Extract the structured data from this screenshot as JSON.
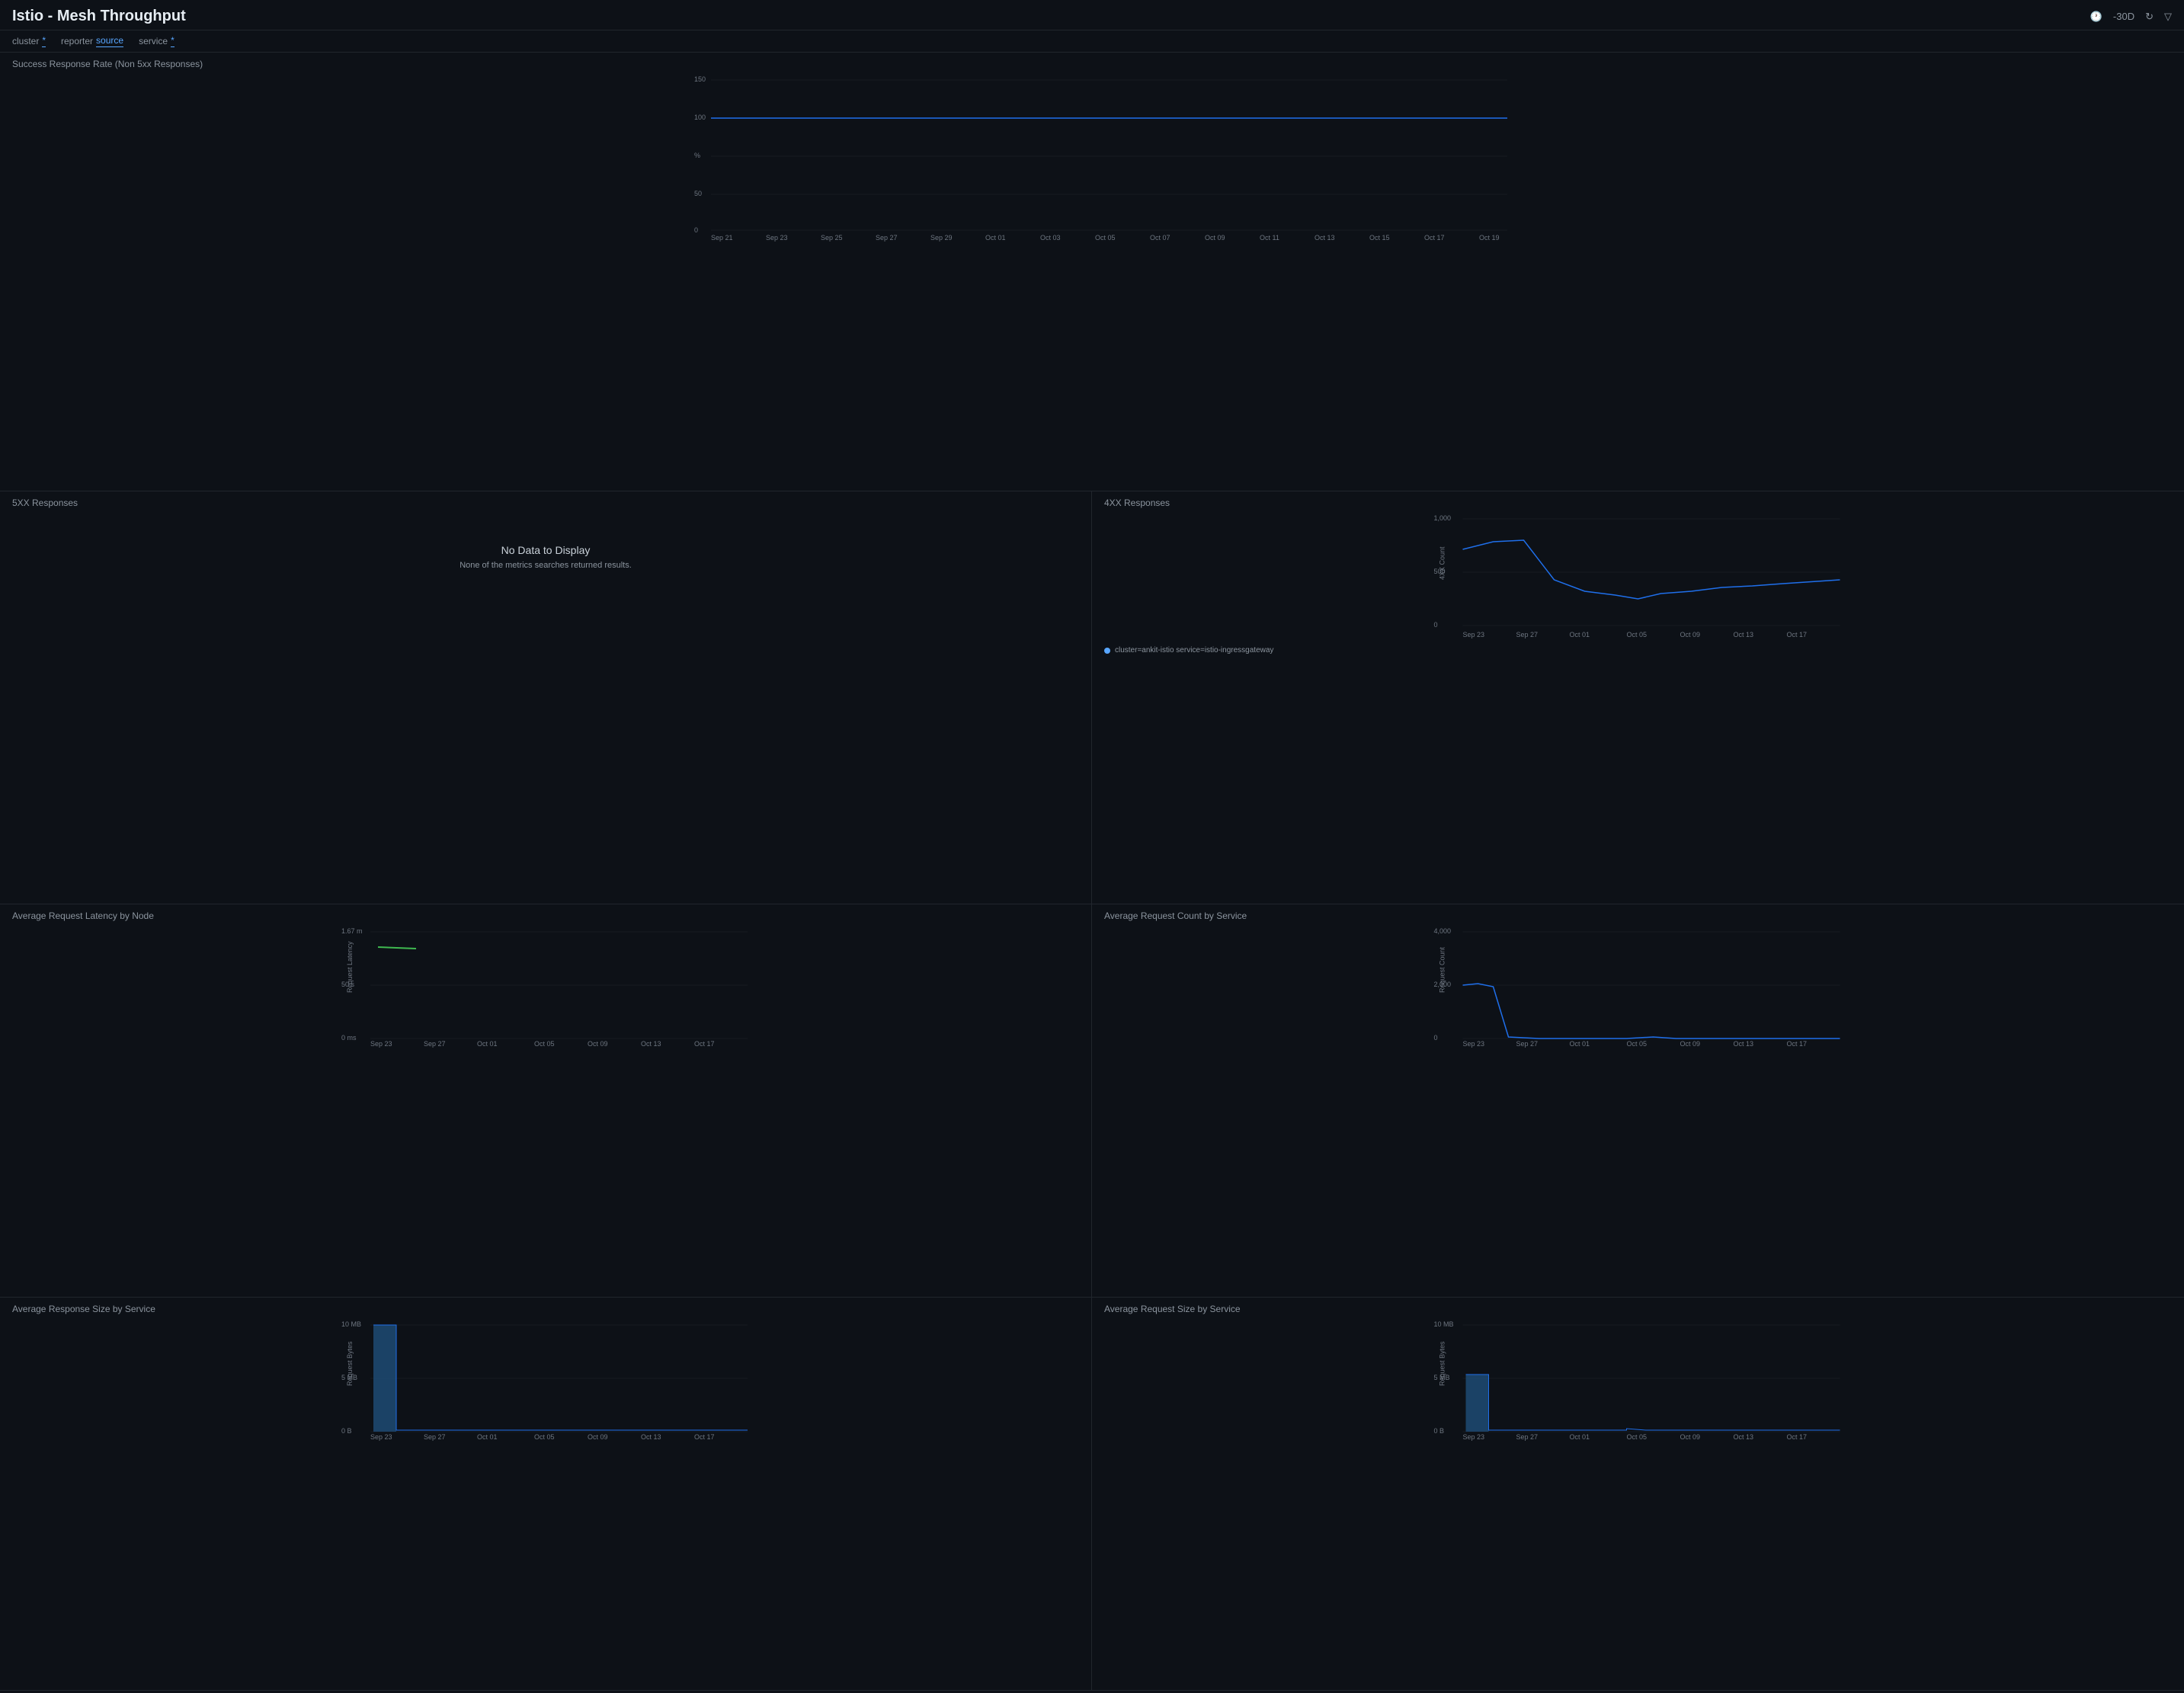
{
  "header": {
    "title": "Istio - Mesh Throughput",
    "timeRange": "-30D",
    "icons": {
      "clock": "🕐",
      "refresh": "↻",
      "filter": "⊽"
    }
  },
  "filterBar": {
    "filters": [
      {
        "label": "cluster",
        "value": "*"
      },
      {
        "label": "reporter",
        "value": "source"
      },
      {
        "label": "service",
        "value": "*"
      }
    ]
  },
  "panels": {
    "successRate": {
      "title": "Success Response Rate (Non 5xx Responses)",
      "yLabels": [
        "150",
        "100",
        "%",
        "50",
        "0"
      ],
      "xLabels": [
        "Sep 21",
        "Sep 23",
        "Sep 25",
        "Sep 27",
        "Sep 29",
        "Oct 01",
        "Oct 03",
        "Oct 05",
        "Oct 07",
        "Oct 09",
        "Oct 11",
        "Oct 13",
        "Oct 15",
        "Oct 17",
        "Oct 19"
      ]
    },
    "fiveXX": {
      "title": "5XX Responses",
      "noData": true,
      "noDataTitle": "No Data to Display",
      "noDataSub": "None of the metrics searches returned results."
    },
    "fourXX": {
      "title": "4XX Responses",
      "yLabels": [
        "1,000",
        "500",
        "0"
      ],
      "xLabels": [
        "Sep 23",
        "Sep 27",
        "Oct 01",
        "Oct 05",
        "Oct 09",
        "Oct 13",
        "Oct 17"
      ],
      "yAxisLabel": "4XX Count",
      "legend": "cluster=ankit-istio service=istio-ingressgateway"
    },
    "avgLatency": {
      "title": "Average Request Latency by Node",
      "yLabels": [
        "1.67 m",
        "50 s",
        "0 ms"
      ],
      "xLabels": [
        "Sep 23",
        "Sep 27",
        "Oct 01",
        "Oct 05",
        "Oct 09",
        "Oct 13",
        "Oct 17"
      ],
      "yAxisLabel": "Request Latency"
    },
    "avgCount": {
      "title": "Average Request Count by Service",
      "yLabels": [
        "4,000",
        "2,000",
        "0"
      ],
      "xLabels": [
        "Sep 23",
        "Sep 27",
        "Oct 01",
        "Oct 05",
        "Oct 09",
        "Oct 13",
        "Oct 17"
      ],
      "yAxisLabel": "Request Count"
    },
    "avgResponseSize": {
      "title": "Average Response Size by Service",
      "yLabels": [
        "10 MB",
        "5 MB",
        "0 B"
      ],
      "xLabels": [
        "Sep 23",
        "Sep 27",
        "Oct 01",
        "Oct 05",
        "Oct 09",
        "Oct 13",
        "Oct 17"
      ],
      "yAxisLabel": "Request Bytes"
    },
    "avgRequestSize": {
      "title": "Average Request Size by Service",
      "yLabels": [
        "10 MB",
        "5 MB",
        "0 B"
      ],
      "xLabels": [
        "Sep 23",
        "Sep 27",
        "Oct 01",
        "Oct 05",
        "Oct 09",
        "Oct 13",
        "Oct 17"
      ],
      "yAxisLabel": "Request Bytes"
    }
  }
}
